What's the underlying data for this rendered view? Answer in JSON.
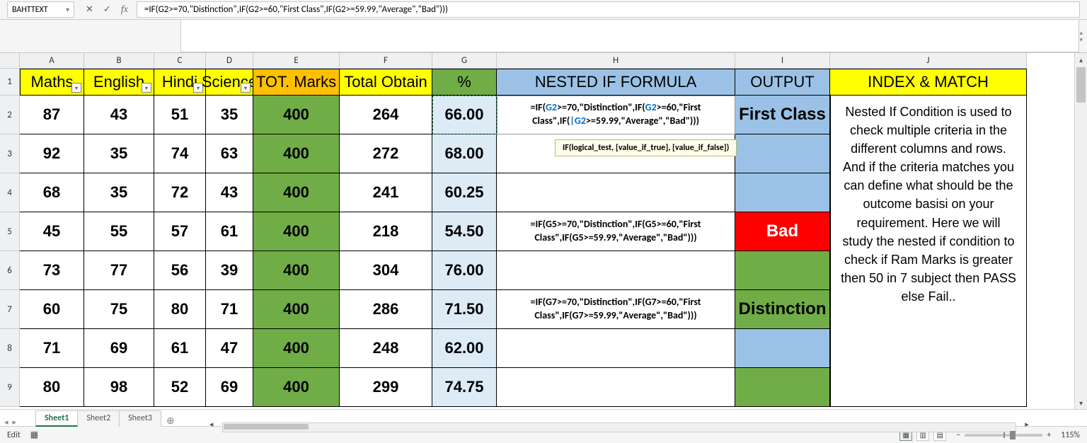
{
  "namebox": "BAHTTEXT",
  "formula_bar": "=IF(G2>=70,\"Distinction\",IF(G2>=60,\"First Class\",IF(G2>=59.99,\"Average\",\"Bad\")))",
  "syntax_tip": {
    "fn": "IF",
    "args": "(logical_test, [value_if_true], [value_if_false])"
  },
  "columns_letters": [
    "A",
    "B",
    "C",
    "D",
    "E",
    "F",
    "G",
    "H",
    "I",
    "J"
  ],
  "row_numbers": [
    "1",
    "2",
    "3",
    "4",
    "5",
    "6",
    "7",
    "8",
    "9"
  ],
  "headers": {
    "A": "Maths",
    "B": "English",
    "C": "Hindi",
    "D": "Science",
    "E": "TOT. Marks",
    "F": "Total Obtain",
    "G": "%",
    "H": "NESTED IF FORMULA",
    "I": "OUTPUT",
    "J": "INDEX & MATCH"
  },
  "rows": [
    {
      "A": "87",
      "B": "43",
      "C": "51",
      "D": "35",
      "E": "400",
      "F": "264",
      "G": "66.00",
      "H_plain": "=IF(G2>=70,\"Distinction\",IF(G2>=60,\"First Class\",IF(G2>=59.99,\"Average\",\"Bad\")))",
      "I": "First Class",
      "I_class": "midblue bold"
    },
    {
      "A": "92",
      "B": "35",
      "C": "74",
      "D": "63",
      "E": "400",
      "F": "272",
      "G": "68.00",
      "H_plain": "",
      "I": "",
      "I_class": "midblue"
    },
    {
      "A": "68",
      "B": "35",
      "C": "72",
      "D": "43",
      "E": "400",
      "F": "241",
      "G": "60.25",
      "H_plain": "",
      "I": "",
      "I_class": "midblue"
    },
    {
      "A": "45",
      "B": "55",
      "C": "57",
      "D": "61",
      "E": "400",
      "F": "218",
      "G": "54.50",
      "H_plain": "=IF(G5>=70,\"Distinction\",IF(G5>=60,\"First Class\",IF(G5>=59.99,\"Average\",\"Bad\")))",
      "I": "Bad",
      "I_class": "red"
    },
    {
      "A": "73",
      "B": "77",
      "C": "56",
      "D": "39",
      "E": "400",
      "F": "304",
      "G": "76.00",
      "H_plain": "",
      "I": "",
      "I_class": "green"
    },
    {
      "A": "60",
      "B": "75",
      "C": "80",
      "D": "71",
      "E": "400",
      "F": "286",
      "G": "71.50",
      "H_plain": "=IF(G7>=70,\"Distinction\",IF(G7>=60,\"First Class\",IF(G7>=59.99,\"Average\",\"Bad\")))",
      "I": "Distinction",
      "I_class": "green bold"
    },
    {
      "A": "71",
      "B": "69",
      "C": "61",
      "D": "47",
      "E": "400",
      "F": "248",
      "G": "62.00",
      "H_plain": "",
      "I": "",
      "I_class": "midblue"
    },
    {
      "A": "80",
      "B": "98",
      "C": "52",
      "D": "69",
      "E": "400",
      "F": "299",
      "G": "74.75",
      "H_plain": "",
      "I": "",
      "I_class": "green"
    }
  ],
  "edit_cell_html_prefix": "=IF(",
  "edit_cell_ref": "G2",
  "edit_row": 2,
  "description": "Nested If Condition is used to check multiple criteria in the different columns and rows. And if the criteria matches you can define what should be the outcome basisi on your requirement. Here we will study the nested if condition to check if Ram Marks is greater then 50 in 7 subject then PASS else Fail..",
  "sheets": [
    "Sheet1",
    "Sheet2",
    "Sheet3"
  ],
  "active_sheet_index": 0,
  "status_mode": "Edit",
  "zoom": "115%"
}
